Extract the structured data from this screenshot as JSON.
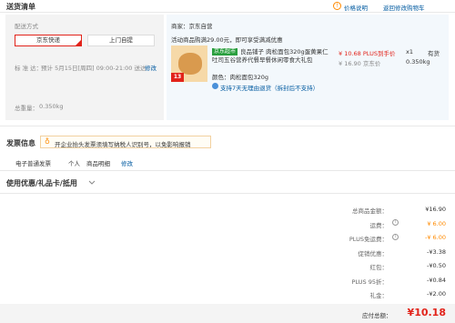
{
  "header": {
    "title": "送货清单",
    "price_note": "价格说明",
    "back_to_cart": "返回修改购物车"
  },
  "delivery": {
    "method_label": "配送方式",
    "options": [
      "京东快递",
      "上门自提"
    ],
    "time_label": "标 准 达：",
    "time_value": "预计 5月15日[周四] 09:00-21:00 送达",
    "modify": "修改",
    "weight_label": "总重量：",
    "weight_value": "0.350kg"
  },
  "shop": {
    "merchant": "商家：京东自营",
    "promo_text": "活动商品购满29.00元，即可享受满减优惠",
    "product_tag": "京东超市",
    "product_name": "良品铺子 肉松面包320g蛋黄果仁吐司五谷营养代餐早餐休闲零食大礼包",
    "product_color": "颜色：肉松面包320g",
    "service": "支持7天无理由退货（拆封后不支持）",
    "price": "¥ 10.68 PLUS到手价",
    "orig_price": "¥ 16.90 京东价",
    "qty": "x1",
    "stock": "有货",
    "item_weight": "0.350kg",
    "thumb_badge": "13"
  },
  "invoice": {
    "title": "发票信息",
    "notice": "开企业抬头发票须填写纳税人识别号，以免影响报销",
    "type": "电子普通发票",
    "who": "个人",
    "content": "商品明细",
    "modify": "修改"
  },
  "coupon": {
    "title": "使用优惠/礼品卡/抵用"
  },
  "summary": {
    "rows": [
      {
        "label": "总商品金额：",
        "value": "¥16.90",
        "type": "normal"
      },
      {
        "label": "运费：",
        "value": "¥ 6.00",
        "type": "orange"
      },
      {
        "label": "PLUS免运费：",
        "value": "-¥ 6.00",
        "type": "orange"
      },
      {
        "label": "促销优惠：",
        "value": "-¥3.38",
        "type": "normal"
      },
      {
        "label": "红包：",
        "value": "-¥0.50",
        "type": "normal"
      },
      {
        "label": "PLUS 95折：",
        "value": "-¥0.84",
        "type": "normal"
      },
      {
        "label": "礼金：",
        "value": "-¥2.00",
        "type": "normal"
      }
    ],
    "payable_label": "应付总额：",
    "payable_value": "¥10.18"
  },
  "colors": {
    "accent": "#e2231a",
    "orange": "#ff8a00",
    "link": "#005aa0"
  }
}
